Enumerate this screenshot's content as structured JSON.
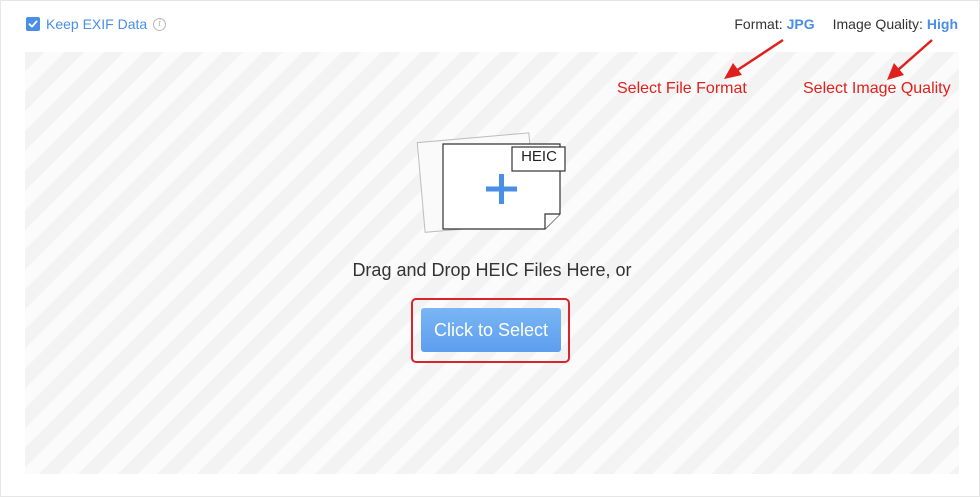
{
  "exif": {
    "label": "Keep EXIF Data",
    "checked": true,
    "info_icon": "info-icon"
  },
  "options": {
    "format_label": "Format:",
    "format_value": "JPG",
    "quality_label": "Image Quality:",
    "quality_value": "High"
  },
  "dropzone": {
    "badge": "HEIC",
    "text": "Drag and Drop HEIC Files Here, or",
    "button": "Click to Select"
  },
  "annotations": {
    "format": "Select File Format",
    "quality": "Select Image Quality"
  },
  "colors": {
    "accent": "#4a8ee6",
    "annotation": "#e0201d",
    "button": "#6aa9f1"
  }
}
